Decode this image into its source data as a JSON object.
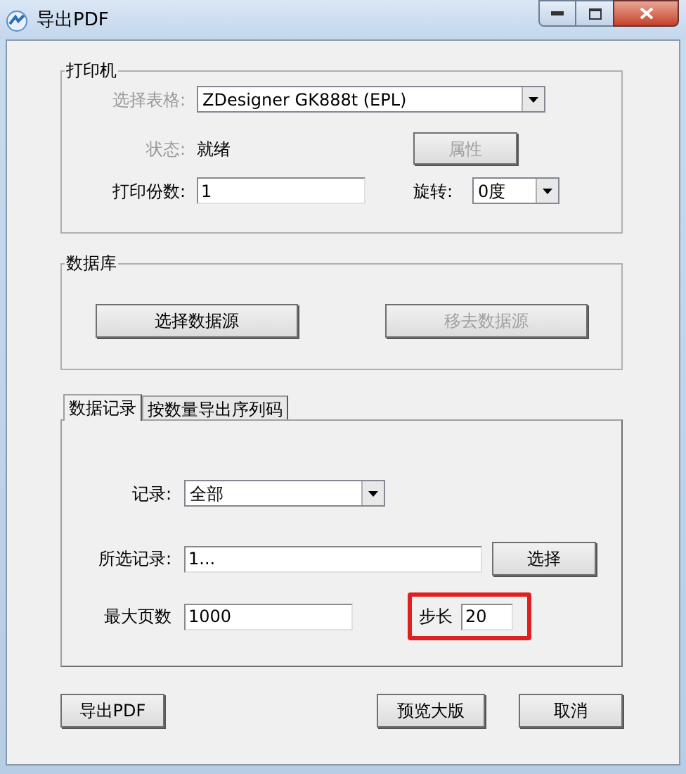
{
  "window": {
    "title": "导出PDF"
  },
  "printer": {
    "title": "打印机",
    "form_label": {
      "text": "选择表格:",
      "disabled": true
    },
    "form_value": "ZDesigner GK888t (EPL)",
    "status_label": {
      "text": "状态:",
      "disabled": true
    },
    "status_value": "就绪",
    "properties_button": {
      "label": "属性",
      "disabled": true
    },
    "copies_label": "打印份数:",
    "copies_value": "1",
    "rotate_label": "旋转:",
    "rotate_value": "0度"
  },
  "database": {
    "title": "数据库",
    "buttons": [
      {
        "label": "选择数据源",
        "disabled": false
      },
      {
        "label": "移去数据源",
        "disabled": true
      }
    ]
  },
  "tabs": [
    {
      "label": "数据记录",
      "selected": true
    },
    {
      "label": "按数量导出序列码",
      "selected": false
    }
  ],
  "records": {
    "record_label": "记录:",
    "record_value": "全部",
    "selected_label": "所选记录:",
    "selected_value": "1...",
    "select_button": "选择",
    "max_pages_label": "最大页数",
    "max_pages_value": "1000",
    "step_label": "步长",
    "step_value": "20",
    "step_highlighted": true
  },
  "footer_buttons": [
    {
      "label": "导出PDF"
    },
    {
      "label": "预览大版"
    },
    {
      "label": "取消"
    }
  ]
}
